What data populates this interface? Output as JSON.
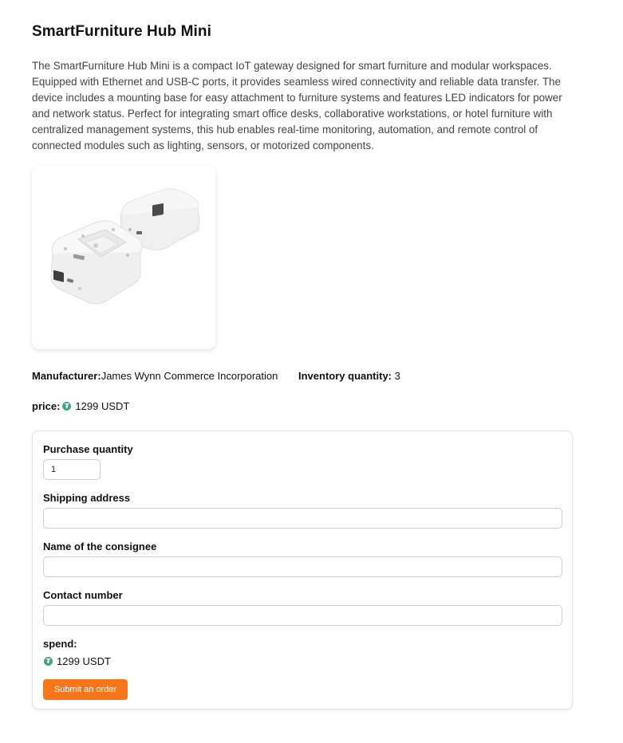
{
  "product": {
    "title": "SmartFurniture Hub Mini",
    "description": "The SmartFurniture Hub Mini is a compact IoT gateway designed for smart furniture and modular workspaces. Equipped with Ethernet and USB-C ports, it provides seamless wired connectivity and reliable data transfer. The device includes a mounting base for easy attachment to furniture systems and features LED indicators for power and network status. Perfect for integrating smart office desks, collaborative workstations, or hotel furniture with centralized management systems, this hub enables real-time monitoring, automation, and remote control of connected modules such as lighting, sensors, or motorized components.",
    "manufacturer_label": "Manufacturer:",
    "manufacturer": "James Wynn Commerce Incorporation",
    "inventory_label": "Inventory quantity:",
    "inventory": "3",
    "price_label": "price:",
    "price": "1299 USDT",
    "currency_icon": "tether-icon",
    "image_icon": "product-photo"
  },
  "form": {
    "quantity_label": "Purchase quantity",
    "quantity_value": "1",
    "address_label": "Shipping address",
    "address_value": "",
    "consignee_label": "Name of the consignee",
    "consignee_value": "",
    "contact_label": "Contact number",
    "contact_value": "",
    "spend_label": "spend:",
    "spend_value": "1299 USDT",
    "submit_label": "Submit an order"
  },
  "colors": {
    "accent": "#f7761a",
    "tether": "#3fa58a",
    "text": "#111111",
    "muted_text": "#444444"
  }
}
